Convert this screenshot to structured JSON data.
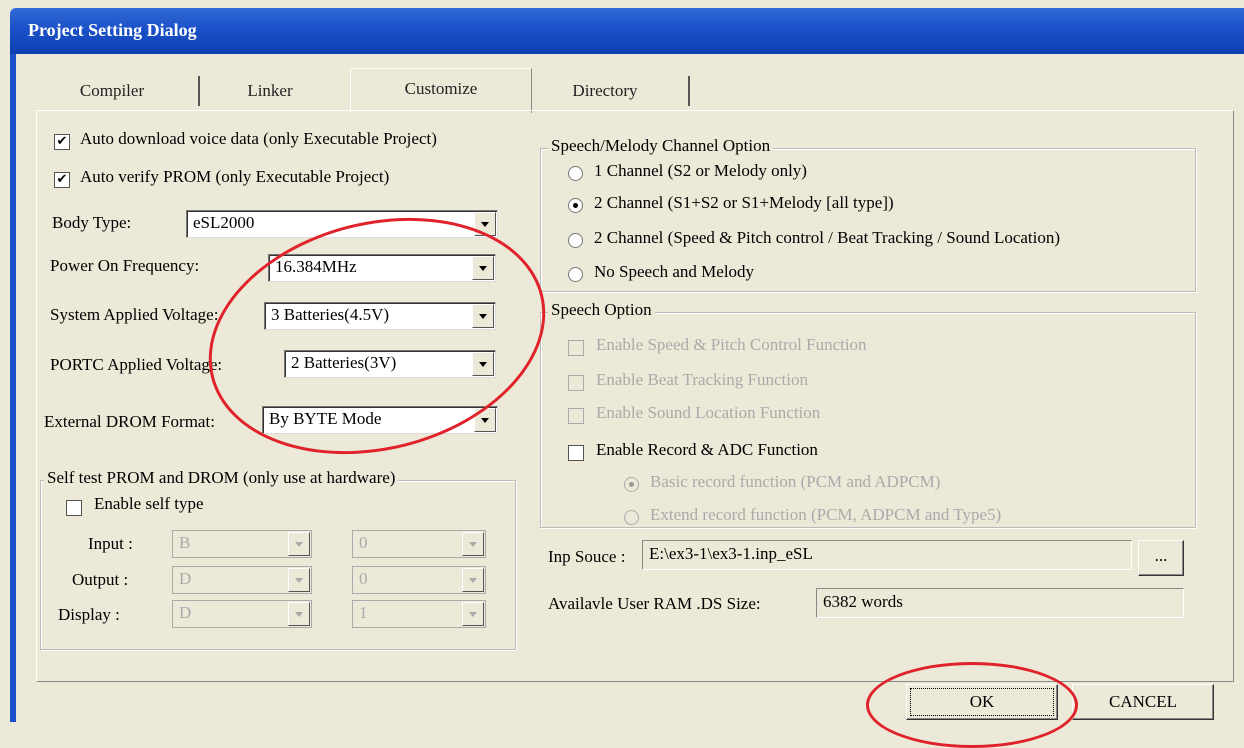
{
  "window": {
    "title": "Project Setting Dialog"
  },
  "tabs": [
    {
      "label": "Compiler"
    },
    {
      "label": "Linker"
    },
    {
      "label": "Customize",
      "selected": true
    },
    {
      "label": "Directory"
    }
  ],
  "left": {
    "auto_download": {
      "label": "Auto download voice data (only Executable Project)",
      "checked": true
    },
    "auto_verify": {
      "label": "Auto verify PROM (only Executable Project)",
      "checked": true
    },
    "body_type": {
      "label": "Body Type:",
      "value": "eSL2000"
    },
    "power_freq": {
      "label": "Power On Frequency:",
      "value": "16.384MHz"
    },
    "sys_voltage": {
      "label": "System Applied Voltage:",
      "value": "3 Batteries(4.5V)"
    },
    "portc_voltage": {
      "label": "PORTC Applied Voltage:",
      "value": "2 Batteries(3V)"
    },
    "drom_format": {
      "label": "External DROM Format:",
      "value": "By BYTE Mode"
    }
  },
  "self_test": {
    "title": "Self test PROM and DROM (only use at hardware)",
    "enable": {
      "label": "Enable self type",
      "checked": false
    },
    "rows": [
      {
        "label": "Input :",
        "a": "B",
        "b": "0"
      },
      {
        "label": "Output :",
        "a": "D",
        "b": "0"
      },
      {
        "label": "Display :",
        "a": "D",
        "b": "1"
      }
    ]
  },
  "channel": {
    "title": "Speech/Melody Channel Option",
    "options": [
      {
        "label": "1 Channel (S2 or Melody only)",
        "selected": false
      },
      {
        "label": "2 Channel (S1+S2 or S1+Melody [all type])",
        "selected": true
      },
      {
        "label": "2 Channel (Speed & Pitch control / Beat Tracking / Sound Location)",
        "selected": false
      },
      {
        "label": "No Speech and Melody",
        "selected": false
      }
    ]
  },
  "speech": {
    "title": "Speech Option",
    "options": [
      {
        "label": "Enable Speed & Pitch Control Function",
        "enabled": false
      },
      {
        "label": "Enable Beat Tracking Function",
        "enabled": false
      },
      {
        "label": "Enable Sound Location Function",
        "enabled": false
      },
      {
        "label": "Enable Record & ADC Function",
        "enabled": true
      }
    ],
    "record_modes": [
      {
        "label": "Basic record function (PCM and ADPCM)",
        "selected": true
      },
      {
        "label": "Extend record function (PCM, ADPCM and Type5)",
        "selected": false
      }
    ]
  },
  "inp_source": {
    "label": "Inp Souce :",
    "value": "E:\\ex3-1\\ex3-1.inp_eSL",
    "browse": "..."
  },
  "ram": {
    "label": "Availavle User RAM .DS Size:",
    "value": "6382 words"
  },
  "buttons": {
    "ok": "OK",
    "cancel": "CANCEL"
  },
  "colors": {
    "title_bar": "#1b51c8",
    "dialog_bg": "#ece9d8",
    "annotation": "#e0222a"
  }
}
